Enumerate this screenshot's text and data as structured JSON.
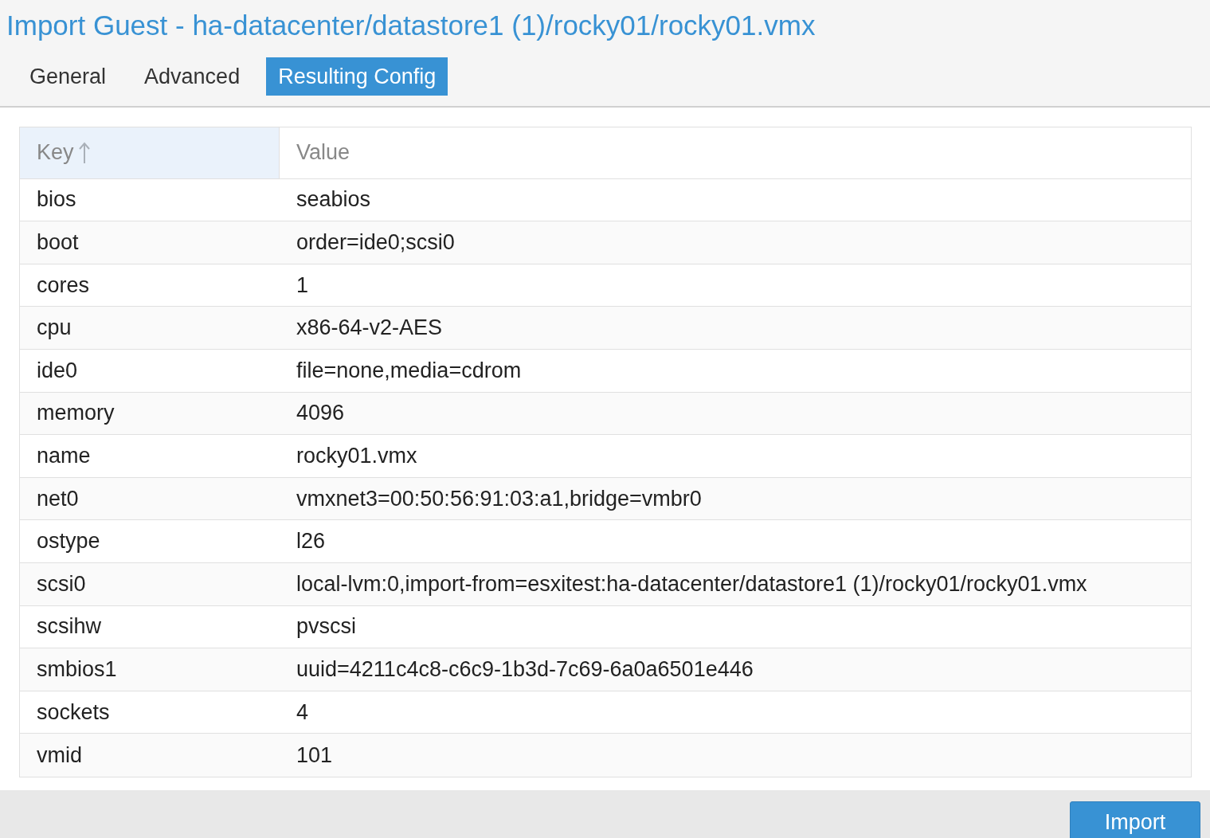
{
  "window": {
    "title": "Import Guest - ha-datacenter/datastore1 (1)/rocky01/rocky01.vmx"
  },
  "tabs": [
    {
      "label": "General",
      "selected": false
    },
    {
      "label": "Advanced",
      "selected": false
    },
    {
      "label": "Resulting Config",
      "selected": true
    }
  ],
  "table": {
    "columns": [
      {
        "label": "Key",
        "sorted": true
      },
      {
        "label": "Value",
        "sorted": false
      }
    ],
    "rows": [
      {
        "key": "bios",
        "value": "seabios"
      },
      {
        "key": "boot",
        "value": "order=ide0;scsi0"
      },
      {
        "key": "cores",
        "value": "1"
      },
      {
        "key": "cpu",
        "value": "x86-64-v2-AES"
      },
      {
        "key": "ide0",
        "value": "file=none,media=cdrom"
      },
      {
        "key": "memory",
        "value": "4096"
      },
      {
        "key": "name",
        "value": "rocky01.vmx"
      },
      {
        "key": "net0",
        "value": "vmxnet3=00:50:56:91:03:a1,bridge=vmbr0"
      },
      {
        "key": "ostype",
        "value": "l26"
      },
      {
        "key": "scsi0",
        "value": "local-lvm:0,import-from=esxitest:ha-datacenter/datastore1 (1)/rocky01/rocky01.vmx"
      },
      {
        "key": "scsihw",
        "value": "pvscsi"
      },
      {
        "key": "smbios1",
        "value": "uuid=4211c4c8-c6c9-1b3d-7c69-6a0a6501e446"
      },
      {
        "key": "sockets",
        "value": "4"
      },
      {
        "key": "vmid",
        "value": "101"
      }
    ]
  },
  "buttons": [
    {
      "label": "Import"
    }
  ]
}
